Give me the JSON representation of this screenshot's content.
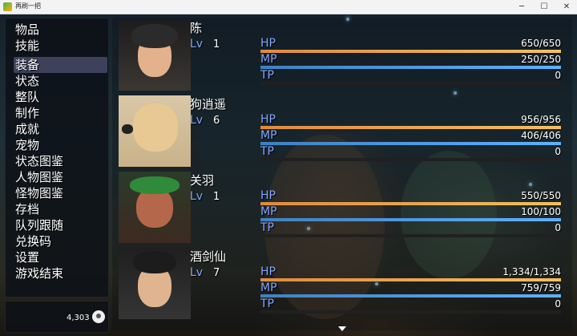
{
  "window": {
    "title": "再刷一把"
  },
  "menu": {
    "items": [
      {
        "label": "物品"
      },
      {
        "label": "技能"
      },
      {
        "label": "装备"
      },
      {
        "label": "状态"
      },
      {
        "label": "整队"
      },
      {
        "label": "制作"
      },
      {
        "label": "成就"
      },
      {
        "label": "宠物"
      },
      {
        "label": "状态图鉴"
      },
      {
        "label": "人物图鉴"
      },
      {
        "label": "怪物图鉴"
      },
      {
        "label": "存档"
      },
      {
        "label": "队列跟随"
      },
      {
        "label": "兑换码"
      },
      {
        "label": "设置"
      },
      {
        "label": "游戏结束"
      }
    ],
    "selected": "装备"
  },
  "gold": {
    "amount": "4,303",
    "icon": "money-bag-icon"
  },
  "labels": {
    "lv": "Lv",
    "hp": "HP",
    "mp": "MP",
    "tp": "TP"
  },
  "actors": [
    {
      "name": "陈",
      "level": "1",
      "hp": "650/650",
      "mp": "250/250",
      "tp": "0",
      "hp_ratio": 1.0,
      "mp_ratio": 1.0,
      "tp_ratio": 0
    },
    {
      "name": "狗逍遥",
      "level": "6",
      "hp": "956/956",
      "mp": "406/406",
      "tp": "0",
      "hp_ratio": 1.0,
      "mp_ratio": 1.0,
      "tp_ratio": 0
    },
    {
      "name": "关羽",
      "level": "1",
      "hp": "550/550",
      "mp": "100/100",
      "tp": "0",
      "hp_ratio": 1.0,
      "mp_ratio": 1.0,
      "tp_ratio": 0
    },
    {
      "name": "酒剑仙",
      "level": "7",
      "hp": "1,334/1,334",
      "mp": "759/759",
      "tp": "0",
      "hp_ratio": 1.0,
      "mp_ratio": 1.0,
      "tp_ratio": 0
    }
  ],
  "colors": {
    "hp": "#e8a050",
    "mp": "#5096e0",
    "tp": "#80d060",
    "system": "#84a7ff"
  }
}
